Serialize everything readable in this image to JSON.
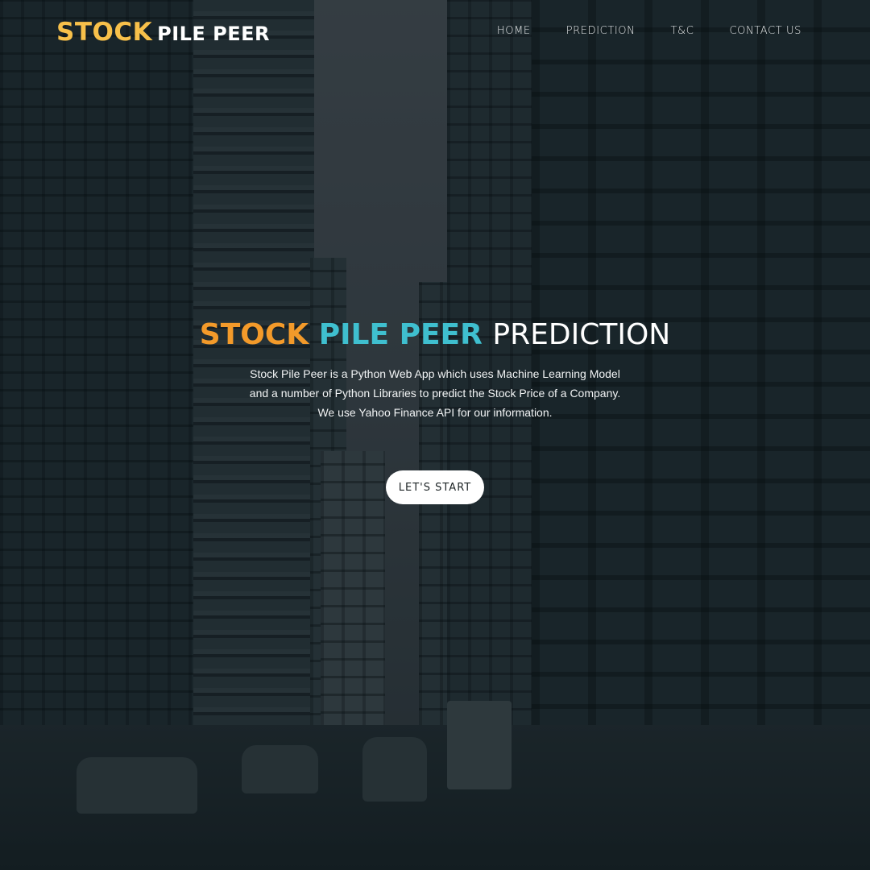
{
  "brand": {
    "logo_primary": "STOCK",
    "logo_secondary": "PILE PEER",
    "colors": {
      "logo_primary": "#f7c04a",
      "title_stock": "#f39a2a",
      "title_pile_peer": "#3fbfcf",
      "text": "#ffffff"
    }
  },
  "nav": {
    "items": [
      {
        "label": "HOME"
      },
      {
        "label": "PREDICTION"
      },
      {
        "label": "T&C"
      },
      {
        "label": "CONTACT US"
      }
    ]
  },
  "hero": {
    "title_part1": "STOCK",
    "title_part2": "PILE PEER",
    "title_part3": "PREDICTION",
    "description_lines": [
      "Stock Pile Peer is a Python Web App which uses Machine Learning Model",
      "and a number of Python Libraries to predict the Stock Price of a Company.",
      "We use Yahoo Finance API for our information."
    ],
    "cta_label": "LET'S START"
  }
}
